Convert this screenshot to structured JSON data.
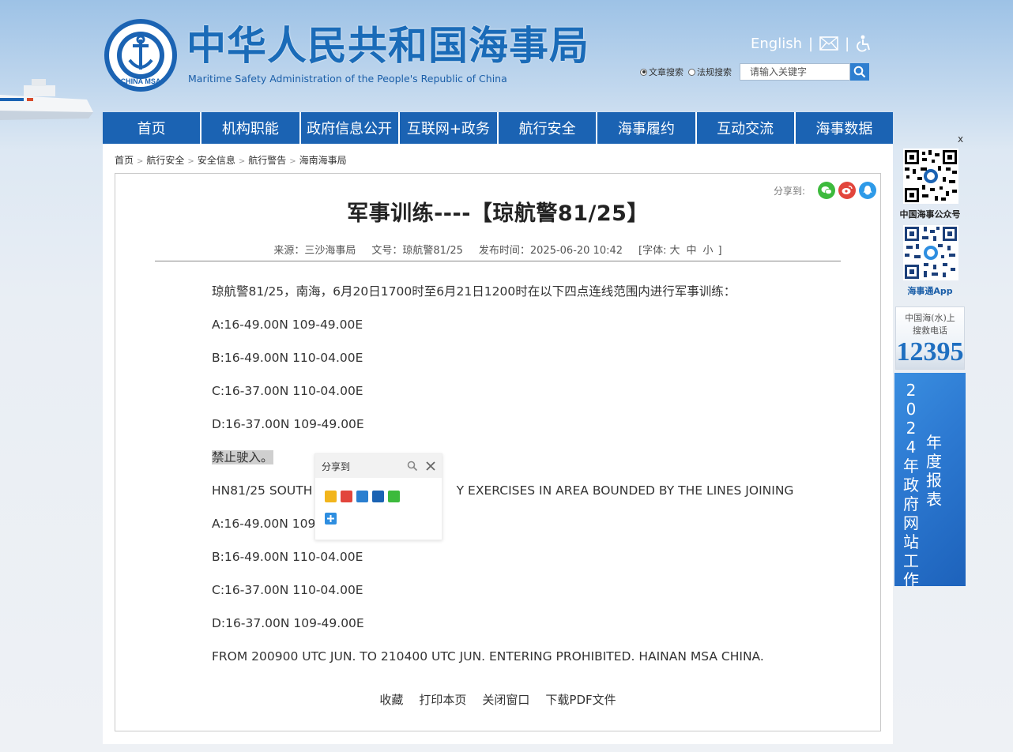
{
  "header": {
    "title": "中华人民共和国海事局",
    "subtitle": "Maritime Safety Administration of the People's Republic of China",
    "english_label": "English",
    "search": {
      "option_article": "文章搜索",
      "option_law": "法规搜索",
      "placeholder": "请输入关键字"
    },
    "icons": [
      "mail-icon",
      "accessibility-icon",
      "search-icon"
    ]
  },
  "nav": {
    "items": [
      "首页",
      "机构职能",
      "政府信息公开",
      "互联网+政务",
      "航行安全",
      "海事履约",
      "互动交流",
      "海事数据"
    ]
  },
  "breadcrumb": {
    "items": [
      "首页",
      "航行安全",
      "安全信息",
      "航行警告",
      "海南海事局"
    ],
    "separator": ">"
  },
  "article": {
    "share_label": "分享到:",
    "title": "军事训练----【琼航警81/25】",
    "meta": {
      "source": "来源：三沙海事局",
      "doc_no": "文号：琼航警81/25",
      "published": "发布时间：2025-06-20 10:42",
      "font_label": "[字体:",
      "font_large": "大",
      "font_medium": "中",
      "font_small": "小",
      "font_end": "]"
    },
    "paragraphs": [
      "琼航警81/25，南海，6月20日1700时至6月21日1200时在以下四点连线范围内进行军事训练：",
      "A:16-49.00N 109-49.00E",
      "B:16-49.00N 110-04.00E",
      "C:16-37.00N 110-04.00E",
      "D:16-37.00N 109-49.00E",
      "禁止驶入。",
      "HN81/25 SOUTH                                     Y EXERCISES IN AREA BOUNDED BY THE LINES JOINING",
      "A:16-49.00N 109-",
      "B:16-49.00N 110-04.00E",
      "C:16-37.00N 110-04.00E",
      "D:16-37.00N 109-49.00E",
      "FROM 200900 UTC JUN. TO 210400 UTC JUN. ENTERING PROHIBITED. HAINAN MSA CHINA."
    ],
    "actions": [
      "收藏",
      "打印本页",
      "关闭窗口",
      "下载PDF文件"
    ]
  },
  "share_popup": {
    "title": "分享到"
  },
  "sidebar": {
    "close_label": "x",
    "qr1_label": "中国海事公众号",
    "qr2_label": "海事通App",
    "hotline_label_1": "中国海(水)上",
    "hotline_label_2": "搜救电话",
    "hotline_number": "12395",
    "annual_col1": "2024年政府网站工作",
    "annual_col2": "年度报表"
  },
  "colors": {
    "nav_bg": "#1b63b3",
    "title_blue": "#1a6bb8",
    "hotline_blue": "#1f6fc0"
  }
}
